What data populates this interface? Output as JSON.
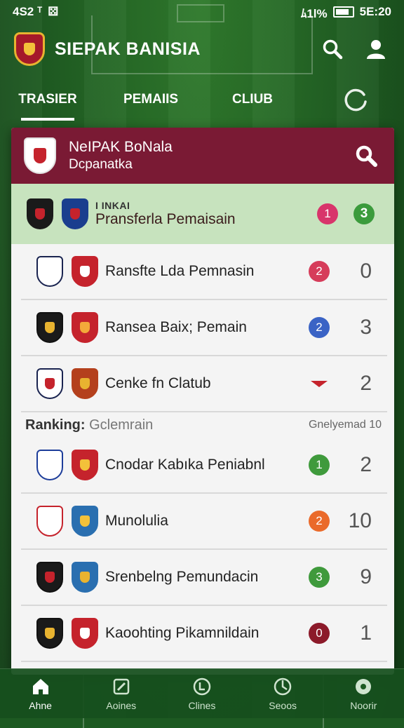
{
  "status_bar": {
    "time_left": "4S2 ᵀ",
    "signal": "ﾑ1l%",
    "clock": "5E:20"
  },
  "app": {
    "title": "SIEPAK BANISIA"
  },
  "tabs": [
    {
      "label": "TRASIER",
      "active": true
    },
    {
      "label": "PEMAIIS",
      "active": false
    },
    {
      "label": "CLIUB",
      "active": false
    }
  ],
  "card_header": {
    "title": "NeIPAK BoNala",
    "subtitle": "Dcpanatka"
  },
  "rows_top": [
    {
      "kicker": "I INKAI",
      "label": "Pransferla Pemaisain",
      "badge": "1",
      "badge_color": "#d8356b",
      "score": "3",
      "score_style": "pill",
      "highlight": true,
      "crest_a": {
        "border": "#1a1a1a",
        "fill": "#c5232c"
      },
      "crest_b": {
        "border": "#1a3e8e",
        "fill": "#c5232c"
      }
    },
    {
      "label": "Ransfte Lda Pemnasin",
      "badge": "2",
      "badge_color": "#d63c5a",
      "score": "0",
      "crest_a": {
        "border": "#1a2450",
        "fill": "#ffffff"
      },
      "crest_b": {
        "border": "#c5232c",
        "fill": "#ffffff"
      }
    },
    {
      "label": "Ransea Baix; Pemain",
      "badge": "2",
      "badge_color": "#3a63c5",
      "score": "3",
      "crest_a": {
        "border": "#111111",
        "fill": "#e8b330"
      },
      "crest_b": {
        "border": "#c5232c",
        "fill": "#f3a93a"
      }
    },
    {
      "label": "Cenke fn Clatub",
      "badge": "",
      "score": "2",
      "arrow": "down",
      "crest_a": {
        "border": "#1a2450",
        "fill": "#c5232c"
      },
      "crest_b": {
        "border": "#b4401d",
        "fill": "#e8b330"
      }
    }
  ],
  "section": {
    "left_label": "Ranking:",
    "left_value": "Gclemrain",
    "right_label": "Gnelyemad 10"
  },
  "rows_bottom": [
    {
      "label": "Cnodar Kabıka Peniabnl",
      "badge": "1",
      "badge_color": "#3f9a3c",
      "score": "2",
      "crest_a": {
        "border": "#1d3d9a",
        "fill": "#ffffff"
      },
      "crest_b": {
        "border": "#c5232c",
        "fill": "#f3c13a"
      }
    },
    {
      "label": "Munolulia",
      "badge": "2",
      "badge_color": "#ea6a2a",
      "score": "10",
      "crest_a": {
        "border": "#c5232c",
        "fill": "#ffffff"
      },
      "crest_b": {
        "border": "#2a6fb0",
        "fill": "#f3c13a"
      }
    },
    {
      "label": "Srenbelng Pemundacin",
      "badge": "3",
      "badge_color": "#3f9a3c",
      "score": "9",
      "crest_a": {
        "border": "#111111",
        "fill": "#c5232c"
      },
      "crest_b": {
        "border": "#2a6fb0",
        "fill": "#e8b330"
      }
    },
    {
      "label": "Kaoohting Pikamnildain",
      "badge": "0",
      "badge_color": "#8c1a2a",
      "score": "1",
      "crest_a": {
        "border": "#111111",
        "fill": "#e8b330"
      },
      "crest_b": {
        "border": "#c5232c",
        "fill": "#ffffff"
      }
    }
  ],
  "bottom_nav": [
    {
      "label": "Ahne",
      "icon": "home-icon",
      "active": true
    },
    {
      "label": "Aoines",
      "icon": "edit-icon",
      "active": false
    },
    {
      "label": "Clines",
      "icon": "club-icon",
      "active": false
    },
    {
      "label": "Seoos",
      "icon": "stats-icon",
      "active": false
    },
    {
      "label": "Noorir",
      "icon": "ball-icon",
      "active": false
    }
  ]
}
